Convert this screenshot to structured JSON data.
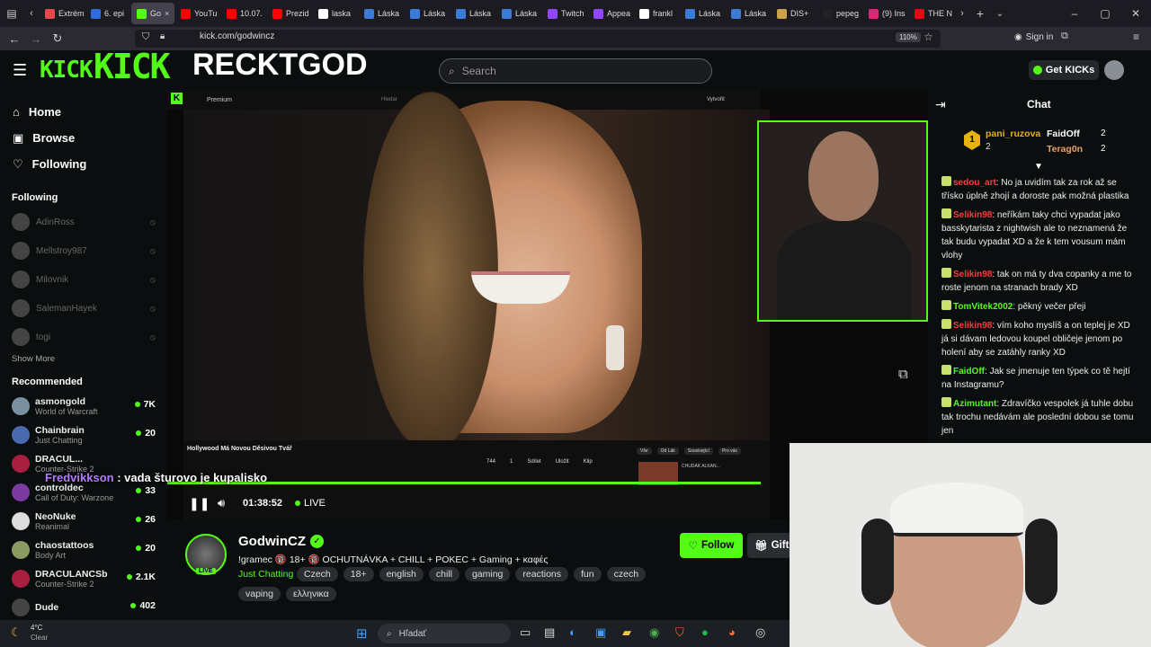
{
  "browser": {
    "tabs": [
      {
        "label": "Extrém",
        "color": "#e5484d"
      },
      {
        "label": "6. epi",
        "color": "#2d6cdf"
      },
      {
        "label": "Go",
        "color": "#53fc18",
        "active": true
      },
      {
        "label": "YouTu",
        "color": "#ff0000"
      },
      {
        "label": "10.07.",
        "color": "#ff0000"
      },
      {
        "label": "Prezid",
        "color": "#ff0000"
      },
      {
        "label": "laska",
        "color": "#ffffff"
      },
      {
        "label": "Láska",
        "color": "#3a7bd5"
      },
      {
        "label": "Láska",
        "color": "#3a7bd5"
      },
      {
        "label": "Láska",
        "color": "#3a7bd5"
      },
      {
        "label": "Láska",
        "color": "#3a7bd5"
      },
      {
        "label": "Twitch",
        "color": "#9146ff"
      },
      {
        "label": "Appea",
        "color": "#9146ff"
      },
      {
        "label": "frankl",
        "color": "#ffffff"
      },
      {
        "label": "Láska",
        "color": "#3a7bd5"
      },
      {
        "label": "Láska",
        "color": "#3a7bd5"
      },
      {
        "label": "DIS+",
        "color": "#c9a24a"
      },
      {
        "label": "pepeg",
        "color": "#222222"
      },
      {
        "label": "(9) Ins",
        "color": "#d62976"
      },
      {
        "label": "THE N",
        "color": "#e50914"
      }
    ],
    "url": "kick.com/godwincz",
    "zoom": "110%",
    "sign_in": "Sign in"
  },
  "overlay": {
    "kick_logo_small": "KICK",
    "kick_logo_big": "KICK",
    "streamer_title": "RECKTGOD"
  },
  "header": {
    "search_placeholder": "Search",
    "get_kicks": "Get KICKs"
  },
  "sidebar": {
    "nav": [
      {
        "label": "Home",
        "icon": "home-icon"
      },
      {
        "label": "Browse",
        "icon": "browse-icon"
      },
      {
        "label": "Following",
        "icon": "heart-icon"
      }
    ],
    "following_title": "Following",
    "following": [
      "AdinRoss",
      "Mellstroy987",
      "Milovnik",
      "SalemanHayek",
      "togi"
    ],
    "show_more": "Show More",
    "recommended_title": "Recommended",
    "recommended": [
      {
        "name": "asmongold",
        "category": "World of Warcraft",
        "viewers": "7K"
      },
      {
        "name": "Chainbrain",
        "category": "Just Chatting",
        "viewers": "20"
      },
      {
        "name": "DRACUL...",
        "category": "Counter-Strike 2",
        "viewers": ""
      },
      {
        "name": "controldec",
        "category": "Call of Duty: Warzone",
        "viewers": "33"
      },
      {
        "name": "NeoNuke",
        "category": "Reanimal",
        "viewers": "26"
      },
      {
        "name": "chaostattoos",
        "category": "Body Art",
        "viewers": "20"
      },
      {
        "name": "DRACULANCSb",
        "category": "Counter-Strike 2",
        "viewers": "2.1K"
      },
      {
        "name": "Dude",
        "category": "",
        "viewers": "402"
      }
    ]
  },
  "video": {
    "inner_title": "Hollywood Má Novou Děsivou Tvář",
    "inner_likes": "744",
    "inner_dislikes": "1",
    "inner_share": "Sdílet",
    "inner_save": "Uložit",
    "inner_clip": "Klip",
    "yt_premium": "Premium",
    "yt_search": "Hledat",
    "yt_create": "Vytvořit",
    "subtitle_name": "Fredvikkson",
    "subtitle_text": "vada šturovo je kupalisko",
    "time": "01:38:52",
    "live": "LIVE",
    "side_title": "CHUDÁK ALKAN...",
    "side_tags": [
      "Vše",
      "Od Lák",
      "Související",
      "Pro vás"
    ]
  },
  "channel": {
    "name": "GodwinCZ",
    "title": "!gramec 🔞 18+ 🔞 OCHUTNÁVKA + CHILL + POKEC + Gaming + καφές",
    "category": "Just Chatting",
    "tags": [
      "Czech",
      "18+",
      "english",
      "chill",
      "gaming",
      "reactions",
      "fun",
      "czech",
      "vaping",
      "ελληνικα"
    ],
    "follow": "Follow",
    "gift": "Gift",
    "live_badge": "LIVE"
  },
  "chat": {
    "title": "Chat",
    "leaders": [
      {
        "rank": "1",
        "name": "pani_ruzova",
        "count": "2"
      },
      {
        "name": "FaidOff",
        "count": "2"
      },
      {
        "name": "Terag0n",
        "count": "2"
      }
    ],
    "messages": [
      {
        "user": "sedou_art",
        "color": "#ff3b3b",
        "text": "No ja uvidím tak za rok až se třísko úplně zhojí a doroste pak možná plastika"
      },
      {
        "user": "Selikin98",
        "color": "#ff3b3b",
        "text": "neříkám taky chci vypadat jako basskytarista z nightwish ale to neznamená že tak budu vypadat XD a že k tem vousum mám vlohy"
      },
      {
        "user": "Selikin98",
        "color": "#ff3b3b",
        "text": "tak on má ty dva copanky a me to roste jenom na stranach brady XD"
      },
      {
        "user": "TomVitek2002",
        "color": "#53fc18",
        "text": "pěkný večer přeji"
      },
      {
        "user": "Selikin98",
        "color": "#ff3b3b",
        "text": "vím koho myslíš a on teplej je XD já si dávam ledovou koupel obličeje jenom po holení aby se zatáhly ranky XD"
      },
      {
        "user": "FaidOff",
        "color": "#53fc18",
        "text": "Jak se jmenuje ten týpek co tě hejtí na Instagramu?"
      },
      {
        "user": "Azimutant",
        "color": "#53fc18",
        "text": "Zdravíčko vespolek já tuhle dobu tak trochu nedávám ale poslední dobou se tomu jen"
      }
    ]
  },
  "taskbar": {
    "weather_temp": "4°C",
    "weather_text": "Clear",
    "search": "Hľadať"
  }
}
